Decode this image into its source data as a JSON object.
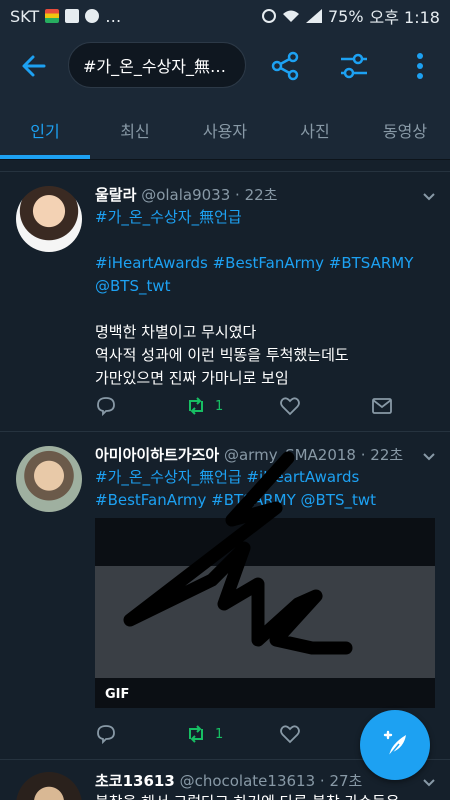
{
  "status_bar": {
    "carrier": "SKT",
    "small_text": "…",
    "battery": "75%",
    "time": "오후 1:18"
  },
  "app_bar": {
    "search_query": "#가_온_수상자_無…"
  },
  "tabs": [
    {
      "label": "인기",
      "active": true
    },
    {
      "label": "최신",
      "active": false
    },
    {
      "label": "사용자",
      "active": false
    },
    {
      "label": "사진",
      "active": false
    },
    {
      "label": "동영상",
      "active": false
    }
  ],
  "tweets": [
    {
      "name": "울랄라",
      "handle": "@olala9033",
      "time": "· 22초",
      "lines": [
        "#가_온_수상자_無언급",
        "",
        "#iHeartAwards #BestFanArmy #BTSARMY",
        "@BTS_twt",
        "",
        "명백한 차별이고 무시였다",
        "역사적 성과에 이런 빅똥을 투척했는데도",
        "가만있으면 진짜 가마니로 보임"
      ],
      "retweets": "1"
    },
    {
      "name": "아미아이하트가즈아",
      "handle": "@army_SMA2018",
      "time": "· 22초",
      "lines": [
        "#가_온_수상자_無언급 #iHeartAwards",
        "#BestFanArmy #BTSARMY @BTS_twt"
      ],
      "gif_label": "GIF",
      "retweets": "1"
    },
    {
      "name": "초코13613",
      "handle": "@chocolate13613",
      "time": "· 27초",
      "lines": [
        "불참을 해서 그렇다고 하기엔 다른 불참 가수들은"
      ]
    }
  ],
  "colors": {
    "background": "#15202b",
    "bar": "#1b2836",
    "accent": "#1da1f2",
    "retweet_green": "#17bf63",
    "muted": "#8899a6"
  }
}
